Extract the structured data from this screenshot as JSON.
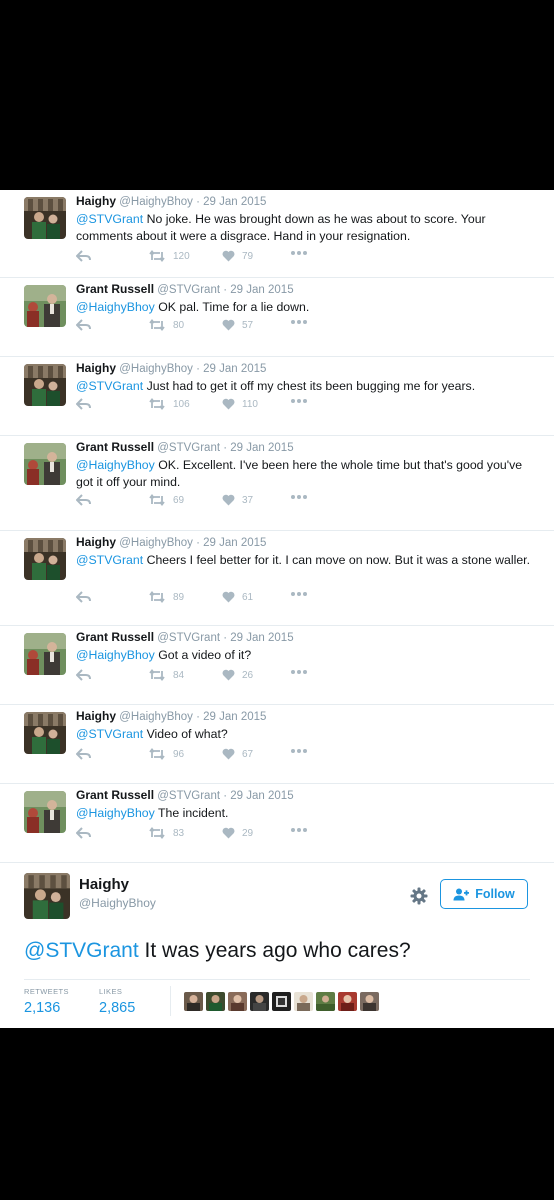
{
  "tweets": [
    {
      "name": "Haighy",
      "handle": "@HaighyBhoy",
      "date": "29 Jan 2015",
      "mention": "@STVGrant",
      "text": " No joke. He was brought down as he was about to score. Your comments about it were a disgrace. Hand in your resignation.",
      "retweets": "120",
      "likes": "79"
    },
    {
      "name": "Grant Russell",
      "handle": "@STVGrant",
      "date": "29 Jan 2015",
      "mention": "@HaighyBhoy",
      "text": " OK pal. Time for a lie down.",
      "retweets": "80",
      "likes": "57"
    },
    {
      "name": "Haighy",
      "handle": "@HaighyBhoy",
      "date": "29 Jan 2015",
      "mention": "@STVGrant",
      "text": " Just had to get it off my chest its been bugging me for years.",
      "retweets": "106",
      "likes": "110"
    },
    {
      "name": "Grant Russell",
      "handle": "@STVGrant",
      "date": "29 Jan 2015",
      "mention": "@HaighyBhoy",
      "text": " OK. Excellent. I've been here the whole time but that's good you've got it off your mind.",
      "retweets": "69",
      "likes": "37"
    },
    {
      "name": "Haighy",
      "handle": "@HaighyBhoy",
      "date": "29 Jan 2015",
      "mention": "@STVGrant",
      "text": " Cheers I feel better for it. I can move on now. But it was a stone waller.",
      "retweets": "89",
      "likes": "61"
    },
    {
      "name": "Grant Russell",
      "handle": "@STVGrant",
      "date": "29 Jan 2015",
      "mention": "@HaighyBhoy",
      "text": " Got a video of it?",
      "retweets": "84",
      "likes": "26"
    },
    {
      "name": "Haighy",
      "handle": "@HaighyBhoy",
      "date": "29 Jan 2015",
      "mention": "@STVGrant",
      "text": " Video of what?",
      "retweets": "96",
      "likes": "67"
    },
    {
      "name": "Grant Russell",
      "handle": "@STVGrant",
      "date": "29 Jan 2015",
      "mention": "@HaighyBhoy",
      "text": " The incident.",
      "retweets": "83",
      "likes": "29"
    }
  ],
  "main": {
    "name": "Haighy",
    "handle": "@HaighyBhoy",
    "follow_label": "Follow",
    "mention": "@STVGrant",
    "text": " It was years ago who cares?",
    "retweets_label": "RETWEETS",
    "retweets": "2,136",
    "likes_label": "LIKES",
    "likes": "2,865"
  },
  "colors": {
    "link": "#1b95e0",
    "text": "#14171a",
    "muted": "#8899a6",
    "icon": "#aab8c2",
    "border": "#e6ecf0"
  },
  "icons": [
    "reply-icon",
    "retweet-icon",
    "heart-icon",
    "more-icon",
    "gear-icon",
    "follow-person-icon"
  ]
}
